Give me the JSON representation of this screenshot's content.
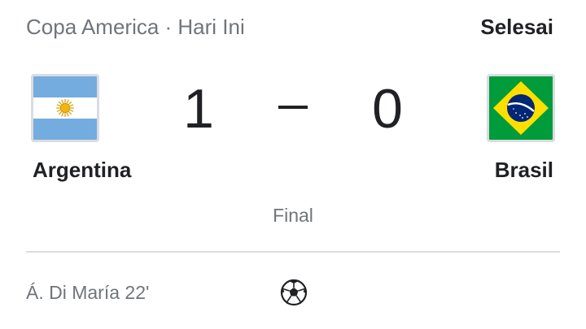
{
  "header": {
    "competition": "Copa America · Hari Ini",
    "status": "Selesai"
  },
  "home": {
    "name": "Argentina",
    "score": "1",
    "flag_icon": "argentina-flag-icon"
  },
  "away": {
    "name": "Brasil",
    "score": "0",
    "flag_icon": "brazil-flag-icon"
  },
  "match": {
    "status": "Final"
  },
  "goals": [
    {
      "scorer": "Á. Di María 22'",
      "icon": "soccer-ball-icon"
    }
  ],
  "colors": {
    "muted_text": "#70757a",
    "primary_text": "#202124",
    "divider": "#dadce0",
    "argentina_blue": "#74acdf",
    "argentina_sun": "#f6b40e",
    "brazil_green": "#009c3b",
    "brazil_yellow": "#ffdf00",
    "brazil_blue": "#002776"
  }
}
